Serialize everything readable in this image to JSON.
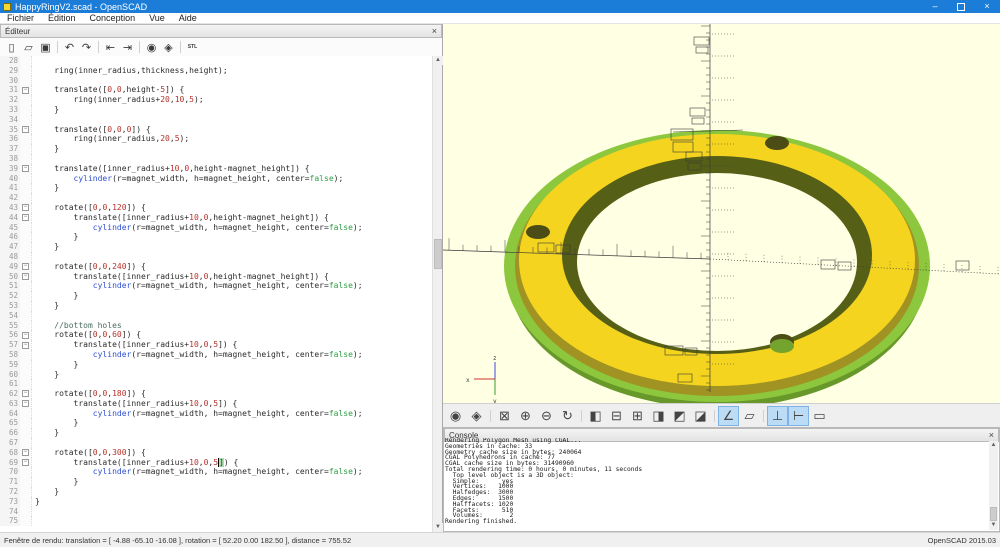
{
  "window": {
    "title": "HappyRingV2.scad - OpenSCAD",
    "minimize_label": "–",
    "close_label": "×"
  },
  "menu_bar": {
    "items": [
      "Fichier",
      "Édition",
      "Conception",
      "Vue",
      "Aide"
    ]
  },
  "editor": {
    "title": "Éditeur",
    "close_label": "×",
    "toolbar": [
      {
        "name": "new-file-icon",
        "glyph": "▯"
      },
      {
        "name": "open-file-icon",
        "glyph": "▱"
      },
      {
        "name": "save-file-icon",
        "glyph": "▣"
      },
      {
        "name": "undo-icon",
        "glyph": "↶",
        "sep_before": true
      },
      {
        "name": "redo-icon",
        "glyph": "↷"
      },
      {
        "name": "unindent-icon",
        "glyph": "⇤",
        "sep_before": true
      },
      {
        "name": "indent-icon",
        "glyph": "⇥"
      },
      {
        "name": "preview-icon",
        "glyph": "◉",
        "sep_before": true
      },
      {
        "name": "render-icon",
        "glyph": "◈"
      },
      {
        "name": "export-stl-icon",
        "glyph": "STL",
        "label": true,
        "sep_before": true
      }
    ],
    "lines": [
      {
        "n": 28,
        "text": ""
      },
      {
        "n": 29,
        "text": "    ring(inner_radius,thickness,height);"
      },
      {
        "n": 30,
        "text": ""
      },
      {
        "n": 31,
        "text": "    translate([0,0,height-5]) {",
        "fold": true
      },
      {
        "n": 32,
        "text": "        ring(inner_radius+20,10,5);"
      },
      {
        "n": 33,
        "text": "    }"
      },
      {
        "n": 34,
        "text": ""
      },
      {
        "n": 35,
        "text": "    translate([0,0,0]) {",
        "fold": true
      },
      {
        "n": 36,
        "text": "        ring(inner_radius,20,5);"
      },
      {
        "n": 37,
        "text": "    }"
      },
      {
        "n": 38,
        "text": ""
      },
      {
        "n": 39,
        "text": "    translate([inner_radius+10,0,height-magnet_height]) {",
        "fold": true
      },
      {
        "n": 40,
        "text": "        cylinder(r=magnet_width, h=magnet_height, center=false);"
      },
      {
        "n": 41,
        "text": "    }"
      },
      {
        "n": 42,
        "text": ""
      },
      {
        "n": 43,
        "text": "    rotate([0,0,120]) {",
        "fold": true
      },
      {
        "n": 44,
        "text": "        translate([inner_radius+10,0,height-magnet_height]) {",
        "fold": true
      },
      {
        "n": 45,
        "text": "            cylinder(r=magnet_width, h=magnet_height, center=false);"
      },
      {
        "n": 46,
        "text": "        }"
      },
      {
        "n": 47,
        "text": "    }"
      },
      {
        "n": 48,
        "text": ""
      },
      {
        "n": 49,
        "text": "    rotate([0,0,240]) {",
        "fold": true
      },
      {
        "n": 50,
        "text": "        translate([inner_radius+10,0,height-magnet_height]) {",
        "fold": true
      },
      {
        "n": 51,
        "text": "            cylinder(r=magnet_width, h=magnet_height, center=false);"
      },
      {
        "n": 52,
        "text": "        }"
      },
      {
        "n": 53,
        "text": "    }"
      },
      {
        "n": 54,
        "text": ""
      },
      {
        "n": 55,
        "text": "    //bottom holes"
      },
      {
        "n": 56,
        "text": "    rotate([0,0,60]) {",
        "fold": true
      },
      {
        "n": 57,
        "text": "        translate([inner_radius+10,0,5]) {",
        "fold": true
      },
      {
        "n": 58,
        "text": "            cylinder(r=magnet_width, h=magnet_height, center=false);"
      },
      {
        "n": 59,
        "text": "        }"
      },
      {
        "n": 60,
        "text": "    }"
      },
      {
        "n": 61,
        "text": ""
      },
      {
        "n": 62,
        "text": "    rotate([0,0,180]) {",
        "fold": true
      },
      {
        "n": 63,
        "text": "        translate([inner_radius+10,0,5]) {",
        "fold": true
      },
      {
        "n": 64,
        "text": "            cylinder(r=magnet_width, h=magnet_height, center=false);"
      },
      {
        "n": 65,
        "text": "        }"
      },
      {
        "n": 66,
        "text": "    }"
      },
      {
        "n": 67,
        "text": ""
      },
      {
        "n": 68,
        "text": "    rotate([0,0,300]) {",
        "fold": true
      },
      {
        "n": 69,
        "text": "        translate([inner_radius+10,0,5]) {",
        "fold": true,
        "caret": true,
        "caret_col": 38
      },
      {
        "n": 70,
        "text": "            cylinder(r=magnet_width, h=magnet_height, center=false);"
      },
      {
        "n": 71,
        "text": "        }"
      },
      {
        "n": 72,
        "text": "    }"
      },
      {
        "n": 73,
        "text": "}"
      },
      {
        "n": 74,
        "text": ""
      },
      {
        "n": 75,
        "text": ""
      }
    ]
  },
  "viewport": {
    "axis_labels": {
      "x": "x",
      "y": "y",
      "z": "z"
    },
    "colors": {
      "bg": "#feffe3",
      "bottom_green": "#68972a",
      "outer_green": "#8cc73d",
      "side_olive": "#a09324",
      "top_yellow": "#f5d41f",
      "inner_dark": "#565f16",
      "hole_dark": "#4c4c16",
      "hole_green": "#74a42e",
      "axis": "#3a3a3a",
      "axis_x": "#cc3333",
      "axis_y": "#33a033",
      "axis_z": "#4444dd"
    },
    "toolbar": [
      {
        "name": "preview-icon",
        "glyph": "◉"
      },
      {
        "name": "render-icon",
        "glyph": "◈"
      },
      {
        "name": "zoom-all-icon",
        "glyph": "⊠",
        "sep_before": true
      },
      {
        "name": "zoom-in-icon",
        "glyph": "⊕"
      },
      {
        "name": "zoom-out-icon",
        "glyph": "⊖"
      },
      {
        "name": "reset-view-icon",
        "glyph": "↻"
      },
      {
        "name": "view-right-icon",
        "glyph": "◧",
        "sep_before": true
      },
      {
        "name": "view-top-icon",
        "glyph": "⊟"
      },
      {
        "name": "view-bottom-icon",
        "glyph": "⊞"
      },
      {
        "name": "view-left-icon",
        "glyph": "◨"
      },
      {
        "name": "view-front-icon",
        "glyph": "◩"
      },
      {
        "name": "view-back-icon",
        "glyph": "◪"
      },
      {
        "name": "perspective-icon",
        "glyph": "∠",
        "active": true,
        "sep_before": true
      },
      {
        "name": "orthogonal-icon",
        "glyph": "▱"
      },
      {
        "name": "show-axes-icon",
        "glyph": "⊥",
        "active": true,
        "sep_before": true
      },
      {
        "name": "show-scale-icon",
        "glyph": "⊢",
        "active": true
      },
      {
        "name": "show-crosshair-icon",
        "glyph": "▭"
      }
    ]
  },
  "console": {
    "title": "Console",
    "close_label": "×",
    "lines": [
      "Rendering Polygon Mesh using CGAL...",
      "Geometries in cache: 33",
      "Geometry cache size in bytes: 240064",
      "CGAL Polyhedrons in cache: 77",
      "CGAL cache size in bytes: 31490960",
      "Total rendering time: 0 hours, 0 minutes, 11 seconds",
      "  Top level object is a 3D object:",
      "  Simple:      yes",
      "  Vertices:   1000",
      "  Halfedges:  3000",
      "  Edges:      1500",
      "  Halffacets: 1020",
      "  Facets:      510",
      "  Volumes:       2",
      "Rendering finished."
    ]
  },
  "status_bar": {
    "left": "Fenêtre de rendu: translation = [ -4.88 -65.10 -16.08 ], rotation = [ 52.20 0.00 182.50 ], distance = 755.52",
    "right": "OpenSCAD 2015.03"
  }
}
